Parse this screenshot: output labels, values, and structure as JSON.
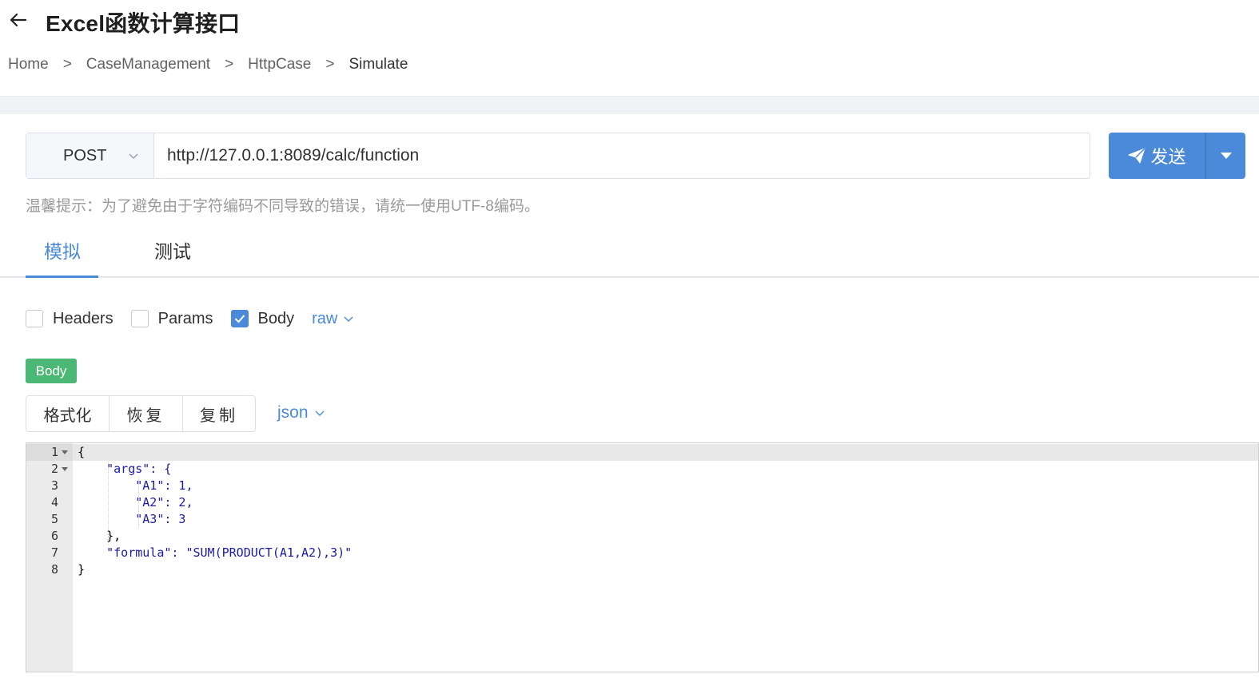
{
  "header": {
    "title": "Excel函数计算接口",
    "breadcrumb": [
      "Home",
      "CaseManagement",
      "HttpCase",
      "Simulate"
    ],
    "separator": ">"
  },
  "request": {
    "method": "POST",
    "url": "http://127.0.0.1:8089/calc/function",
    "send_label": "发送"
  },
  "tip": "温馨提示：为了避免由于字符编码不同导致的错误，请统一使用UTF-8编码。",
  "tabs": [
    {
      "label": "模拟",
      "active": true
    },
    {
      "label": "测试",
      "active": false
    }
  ],
  "options": {
    "headers_label": "Headers",
    "headers_checked": false,
    "params_label": "Params",
    "params_checked": false,
    "body_label": "Body",
    "body_checked": true,
    "body_type": "raw"
  },
  "body_tag": "Body",
  "editor_toolbar": {
    "format_label": "格式化",
    "restore_label": "恢复",
    "copy_label": "复制",
    "language": "json"
  },
  "editor": {
    "line_numbers": [
      "1",
      "2",
      "3",
      "4",
      "5",
      "6",
      "7",
      "8"
    ],
    "lines": [
      "{",
      "    \"args\": {",
      "        \"A1\": 1,",
      "        \"A2\": 2,",
      "        \"A3\": 3",
      "    },",
      "    \"formula\": \"SUM(PRODUCT(A1,A2),3)\"",
      "}"
    ]
  },
  "colors": {
    "primary": "#4a8ad8",
    "success": "#4cb876",
    "band": "#f0f2f5"
  }
}
